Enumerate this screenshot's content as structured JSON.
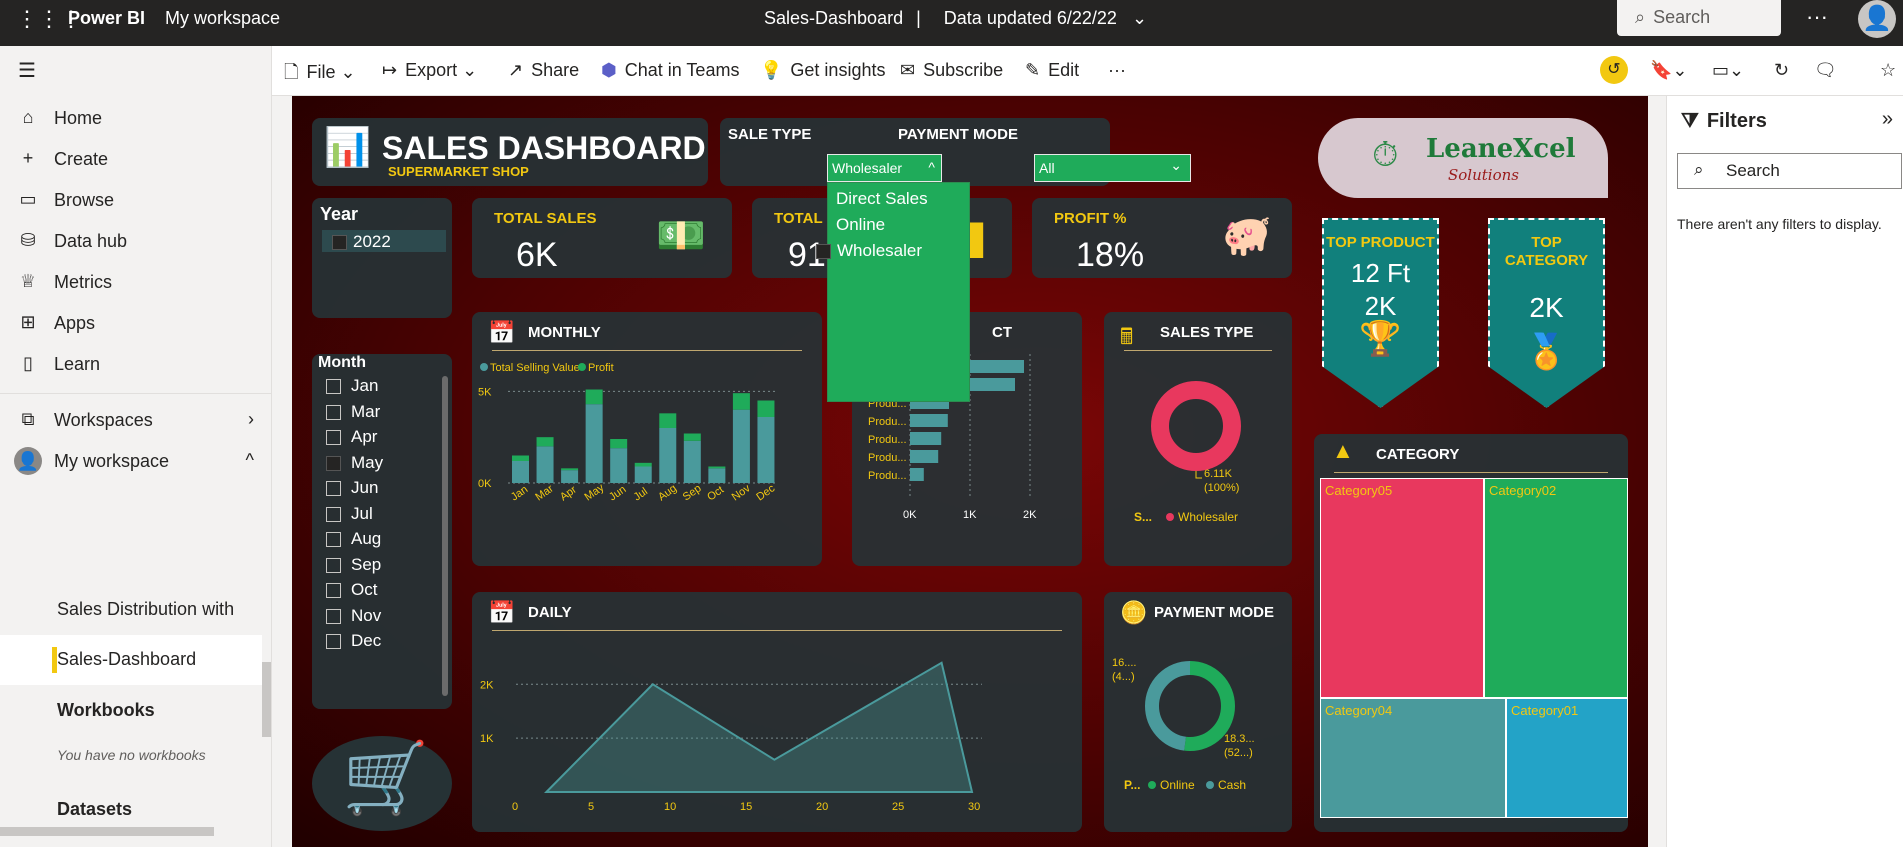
{
  "topbar": {
    "brand": "Power BI",
    "workspace": "My workspace",
    "report": "Sales-Dashboard",
    "separator": "|",
    "updated": "Data updated 6/22/22",
    "search_placeholder": "Search"
  },
  "sidebar": {
    "items": [
      {
        "label": "Home",
        "icon": "home-icon"
      },
      {
        "label": "Create",
        "icon": "plus-icon"
      },
      {
        "label": "Browse",
        "icon": "folder-icon"
      },
      {
        "label": "Data hub",
        "icon": "database-icon"
      },
      {
        "label": "Metrics",
        "icon": "trophy-icon"
      },
      {
        "label": "Apps",
        "icon": "apps-icon"
      },
      {
        "label": "Learn",
        "icon": "book-icon"
      }
    ],
    "workspaces": "Workspaces",
    "my_workspace": "My workspace",
    "sub_items": [
      "Sales Distribution with",
      "Sales-Dashboard"
    ],
    "workbooks": "Workbooks",
    "workbooks_note": "You have no workbooks",
    "datasets": "Datasets"
  },
  "commands": [
    "File",
    "Export",
    "Share",
    "Chat in Teams",
    "Get insights",
    "Subscribe",
    "Edit",
    "···"
  ],
  "dashboard": {
    "title": "SALES DASHBOARD",
    "subtitle": "SUPERMARKET SHOP",
    "year_label": "Year",
    "year_value": "2022",
    "sale_type_label": "SALE TYPE",
    "sale_type_value": "Wholesaler",
    "sale_type_options": [
      "Direct Sales",
      "Online",
      "Wholesaler"
    ],
    "payment_mode_label": "PAYMENT MODE",
    "payment_mode_value": "All",
    "kpis": [
      {
        "title": "TOTAL SALES",
        "value": "6K"
      },
      {
        "title": "TOTAL",
        "value": "91"
      },
      {
        "title": "PROFIT %",
        "value": "18%"
      }
    ],
    "logo": {
      "line1": "LeaneXcel",
      "line2": "Solutions"
    },
    "top_product": {
      "title": "TOP PRODUCT",
      "value1": "12  Ft",
      "value2": "2K"
    },
    "top_category": {
      "title": "TOP CATEGORY",
      "value": "2K"
    },
    "months_label": "Month",
    "months": [
      {
        "name": "Jan",
        "checked": false
      },
      {
        "name": "Mar",
        "checked": false
      },
      {
        "name": "Apr",
        "checked": false
      },
      {
        "name": "May",
        "checked": true
      },
      {
        "name": "Jun",
        "checked": false
      },
      {
        "name": "Jul",
        "checked": false
      },
      {
        "name": "Aug",
        "checked": false
      },
      {
        "name": "Sep",
        "checked": false
      },
      {
        "name": "Oct",
        "checked": false
      },
      {
        "name": "Nov",
        "checked": false
      },
      {
        "name": "Dec",
        "checked": false
      }
    ],
    "monthly_title": "MONTHLY",
    "product_title": "CT",
    "sales_type_title": "SALES TYPE",
    "daily_title": "DAILY",
    "payment_title": "PAYMENT MODE",
    "category_title": "CATEGORY",
    "filters": {
      "title": "Filters",
      "search": "Search",
      "empty": "There aren't any filters to display."
    }
  },
  "chart_data": [
    {
      "type": "bar",
      "title": "MONTHLY",
      "categories": [
        "Jan",
        "Mar",
        "Apr",
        "May",
        "Jun",
        "Jul",
        "Aug",
        "Sep",
        "Oct",
        "Nov",
        "Dec"
      ],
      "series": [
        {
          "name": "Total Selling Value",
          "values": [
            1200,
            2000,
            700,
            4300,
            1900,
            900,
            3000,
            2300,
            800,
            4000,
            3600
          ],
          "color": "#4a9a9c"
        },
        {
          "name": "Profit",
          "values": [
            300,
            500,
            100,
            800,
            500,
            200,
            800,
            400,
            100,
            900,
            900
          ],
          "color": "#1fab5a"
        }
      ],
      "ylim": [
        0,
        6000
      ],
      "yticks": [
        "0K",
        "5K"
      ],
      "stacked": true
    },
    {
      "type": "bar",
      "orientation": "horizontal",
      "categories": [
        "Produ...",
        "Produ...",
        "Produ...",
        "Produ...",
        "Produ...",
        "Produ...",
        "Produ..."
      ],
      "values": [
        1900,
        1750,
        650,
        630,
        520,
        470,
        230
      ],
      "xticks": [
        "0K",
        "1K",
        "2K"
      ],
      "xlim": [
        0,
        2000
      ],
      "color": "#4a9a9c"
    },
    {
      "type": "pie",
      "title": "SALES TYPE",
      "legend_title": "S...",
      "slices": [
        {
          "label": "Wholesaler",
          "value": 6110,
          "display": "6.11K",
          "pct": "(100%)",
          "color": "#e8385e"
        }
      ]
    },
    {
      "type": "area",
      "title": "DAILY",
      "x": [
        2,
        9,
        17,
        28,
        30
      ],
      "y": [
        0,
        2000,
        600,
        2400,
        0
      ],
      "xticks": [
        0,
        5,
        10,
        15,
        20,
        25,
        30
      ],
      "ylabels": [
        "1K",
        "2K"
      ],
      "color": "#4a9a9c"
    },
    {
      "type": "pie",
      "title": "PAYMENT MODE",
      "legend_title": "P...",
      "slices": [
        {
          "label": "Online",
          "value": 52,
          "display": "18.3...",
          "pct": "(52...)",
          "color": "#1fab5a"
        },
        {
          "label": "Cash",
          "value": 48,
          "display": "16....",
          "pct": "(4...)",
          "color": "#4a9a9c"
        }
      ]
    },
    {
      "type": "treemap",
      "title": "CATEGORY",
      "items": [
        {
          "label": "Category05",
          "color": "#e8385e"
        },
        {
          "label": "Category02",
          "color": "#1fab5a"
        },
        {
          "label": "Category04",
          "color": "#4a9a9c"
        },
        {
          "label": "Category01",
          "color": "#23a3c7"
        }
      ]
    }
  ]
}
